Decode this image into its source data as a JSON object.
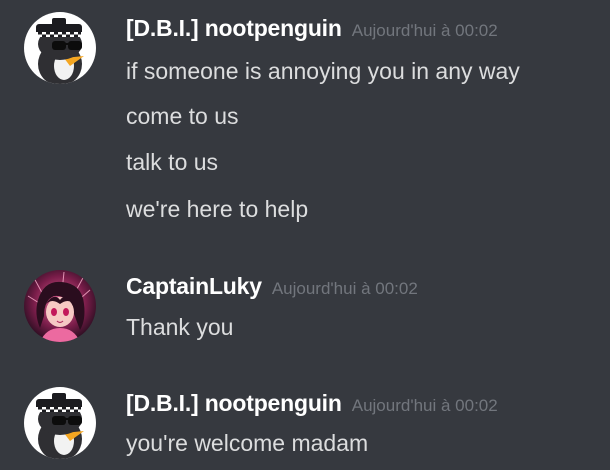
{
  "messages": [
    {
      "username": "[D.B.I.] nootpenguin",
      "timestamp": "Aujourd'hui à 00:02",
      "avatar_icon": "penguin-police-avatar",
      "lines": [
        "if someone is annoying you in any way",
        "come to us",
        "talk to us",
        "we're here to help"
      ]
    },
    {
      "username": "CaptainLuky",
      "timestamp": "Aujourd'hui à 00:02",
      "avatar_icon": "anime-girl-avatar",
      "lines": [
        "Thank you"
      ]
    },
    {
      "username": "[D.B.I.] nootpenguin",
      "timestamp": "Aujourd'hui à 00:02",
      "avatar_icon": "penguin-police-avatar",
      "lines": [
        "you're welcome madam"
      ]
    }
  ],
  "colors": {
    "background": "#36393f",
    "username": "#ffffff",
    "timestamp": "#72767d",
    "message_text": "#dcddde"
  }
}
